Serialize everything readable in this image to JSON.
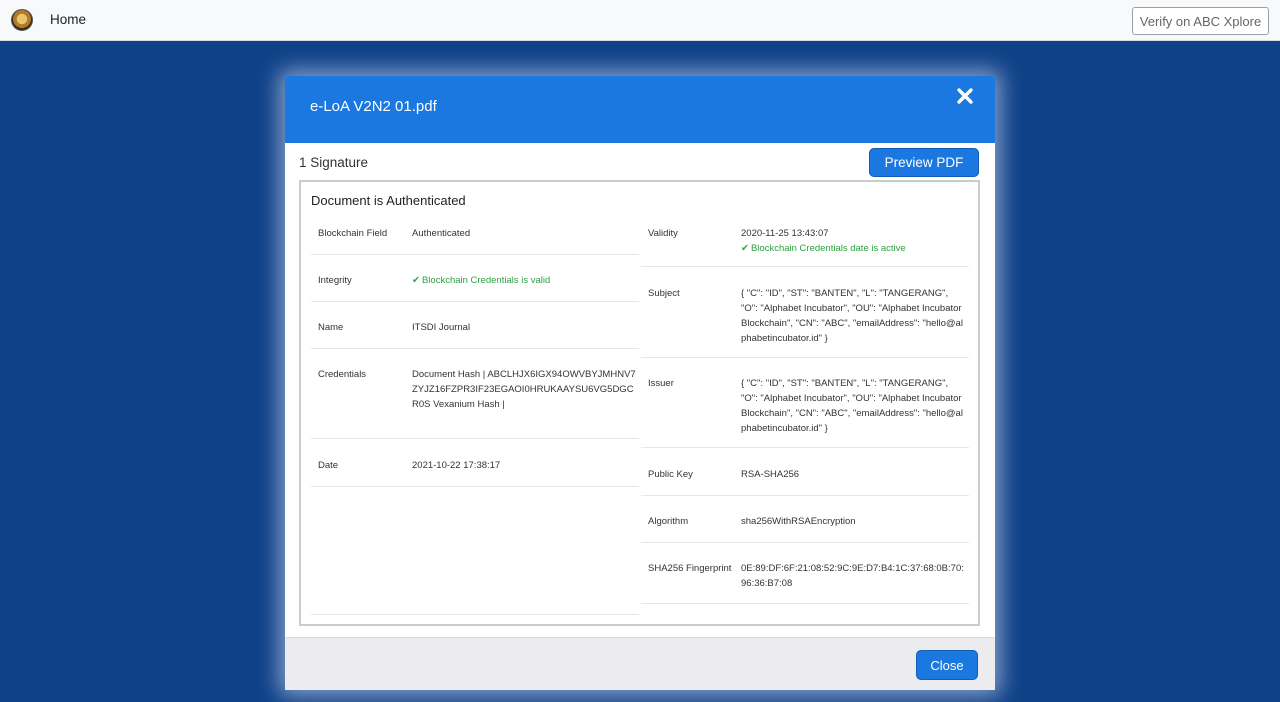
{
  "nav": {
    "home_label": "Home",
    "verify_label": "Verify on ABC Xplore"
  },
  "modal": {
    "title": "e-LoA V2N2 01.pdf",
    "signature_count": "1 Signature",
    "preview_label": "Preview PDF",
    "close_label": "Close"
  },
  "panel": {
    "title": "Document is Authenticated",
    "left": [
      {
        "label": "Blockchain Field",
        "value": "Authenticated"
      },
      {
        "label": "Integrity",
        "value": "Blockchain Credentials is valid"
      },
      {
        "label": "Name",
        "value": "ITSDI Journal"
      },
      {
        "label": "Credentials",
        "value": "Document Hash | ABCLHJX6IGX94OWVBYJMHNV7ZYJZ16FZPR3IF23EGAOI0HRUKAAYSU6VG5DGCR0S Vexanium Hash |"
      },
      {
        "label": "Date",
        "value": "2021-10-22 17:38:17"
      }
    ],
    "right": [
      {
        "label": "Validity",
        "value": "2020-11-25 13:43:07",
        "note": "Blockchain Credentials date is active"
      },
      {
        "label": "Subject",
        "value": "{ \"C\": \"ID\", \"ST\": \"BANTEN\", \"L\": \"TANGERANG\", \"O\": \"Alphabet Incubator\", \"OU\": \"Alphabet Incubator Blockchain\", \"CN\": \"ABC\", \"emailAddress\": \"hello@alphabetincubator.id\" }"
      },
      {
        "label": "Issuer",
        "value": "{ \"C\": \"ID\", \"ST\": \"BANTEN\", \"L\": \"TANGERANG\", \"O\": \"Alphabet Incubator\", \"OU\": \"Alphabet Incubator Blockchain\", \"CN\": \"ABC\", \"emailAddress\": \"hello@alphabetincubator.id\" }"
      },
      {
        "label": "Public Key",
        "value": "RSA-SHA256"
      },
      {
        "label": "Algorithm",
        "value": "sha256WithRSAEncryption"
      },
      {
        "label": "SHA256 Fingerprint",
        "value": "0E:89:DF:6F:21:08:52:9C:9E:D7:B4:1C:37:68:0B:70:96:36:B7:08"
      }
    ]
  },
  "colors": {
    "background": "#0f4188",
    "primary": "#1a78e0",
    "success": "#2ea043"
  }
}
